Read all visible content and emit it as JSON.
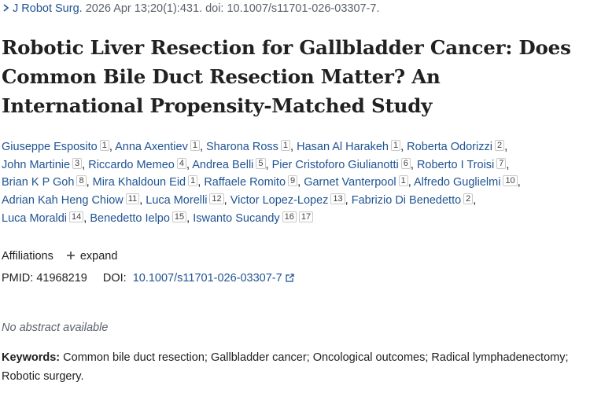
{
  "citation": {
    "journal": "J Robot Surg.",
    "details": "2026 Apr 13;20(1):431. doi: 10.1007/s11701-026-03307-7."
  },
  "title_lines": [
    "Robotic Liver Resection for Gallbladder Cancer: Does",
    "Common Bile Duct Resection Matter? An",
    "International Propensity-Matched Study"
  ],
  "authors": [
    {
      "name": "Giuseppe Esposito",
      "aff": "1"
    },
    {
      "name": "Anna Axentiev",
      "aff": "1"
    },
    {
      "name": "Sharona Ross",
      "aff": "1"
    },
    {
      "name": "Hasan Al Harakeh",
      "aff": "1"
    },
    {
      "name": "Roberta Odorizzi",
      "aff": "2"
    },
    {
      "name": "John Martinie",
      "aff": "3"
    },
    {
      "name": "Riccardo Memeo",
      "aff": "4"
    },
    {
      "name": "Andrea Belli",
      "aff": "5"
    },
    {
      "name": "Pier Cristoforo Giulianotti",
      "aff": "6"
    },
    {
      "name": "Roberto I Troisi",
      "aff": "7"
    },
    {
      "name": "Brian K P Goh",
      "aff": "8"
    },
    {
      "name": "Mira Khaldoun Eid",
      "aff": "1"
    },
    {
      "name": "Raffaele Romito",
      "aff": "9"
    },
    {
      "name": "Garnet Vanterpool",
      "aff": "1"
    },
    {
      "name": "Alfredo Guglielmi",
      "aff": "10"
    },
    {
      "name": "Adrian Kah Heng Chiow",
      "aff": "11"
    },
    {
      "name": "Luca Morelli",
      "aff": "12"
    },
    {
      "name": "Victor Lopez-Lopez",
      "aff": "13"
    },
    {
      "name": "Fabrizio Di Benedetto",
      "aff": "2"
    },
    {
      "name": "Luca Moraldi",
      "aff": "14"
    },
    {
      "name": "Benedetto Ielpo",
      "aff": "15"
    },
    {
      "name": "Iswanto Sucandy",
      "aff": "16",
      "aff2": "17"
    }
  ],
  "affiliations": {
    "label": "Affiliations",
    "expand_label": "expand"
  },
  "ids": {
    "pmid_label": "PMID:",
    "pmid": "41968219",
    "doi_label": "DOI:",
    "doi": "10.1007/s11701-026-03307-7"
  },
  "no_abstract": "No abstract available",
  "keywords": {
    "label": "Keywords:",
    "text": "Common bile duct resection; Gallbladder cancer; Oncological outcomes; Radical lymphadenectomy; Robotic surgery."
  },
  "colors": {
    "link": "#205493",
    "text": "#212121",
    "muted": "#5b616b"
  },
  "icons": {
    "journal": "chevron-right-icon",
    "expand": "plus-icon",
    "doi": "external-link-icon"
  }
}
